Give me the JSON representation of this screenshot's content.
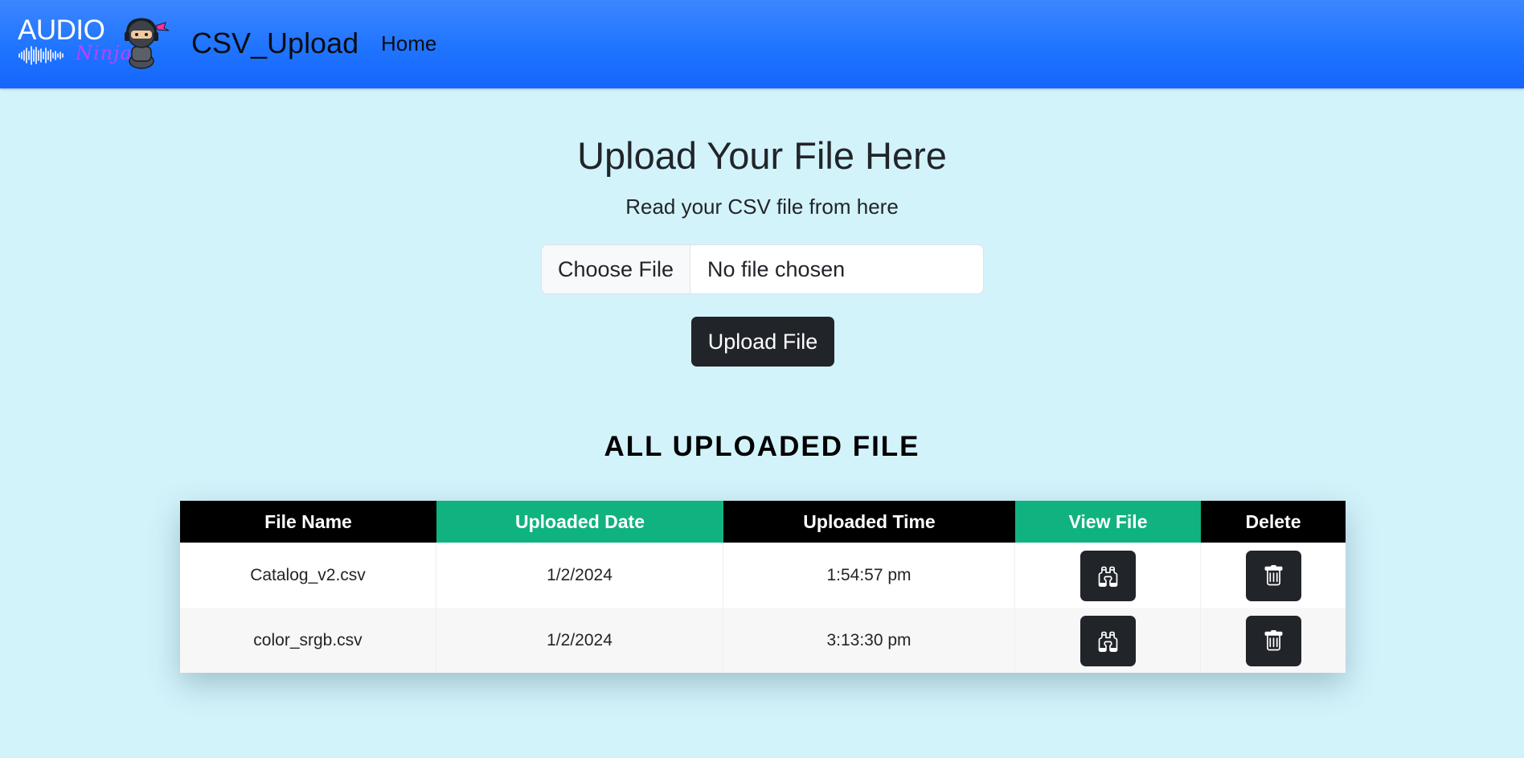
{
  "navbar": {
    "logo": {
      "word": "AUDIO",
      "sub": "Ninja"
    },
    "brand_title": "CSV_Upload",
    "home_link": "Home"
  },
  "upload": {
    "heading": "Upload Your File Here",
    "subheading": "Read your CSV file from here",
    "choose_file_label": "Choose File",
    "file_status": "No file chosen",
    "upload_button_label": "Upload File"
  },
  "files_section": {
    "title": "ALL UPLOADED FILE",
    "columns": [
      "File Name",
      "Uploaded Date",
      "Uploaded Time",
      "View File",
      "Delete"
    ],
    "rows": [
      {
        "file_name": "Catalog_v2.csv",
        "date": "1/2/2024",
        "time": "1:54:57 pm",
        "view_icon": "binoculars-icon",
        "delete_icon": "trash-icon"
      },
      {
        "file_name": "color_srgb.csv",
        "date": "1/2/2024",
        "time": "3:13:30 pm",
        "view_icon": "binoculars-icon",
        "delete_icon": "trash-icon"
      }
    ]
  },
  "colors": {
    "navbar": "#1f74ff",
    "page_background": "#d3f3fb",
    "header_dark": "#000000",
    "header_green": "#10b280",
    "button_dark": "#212529"
  }
}
